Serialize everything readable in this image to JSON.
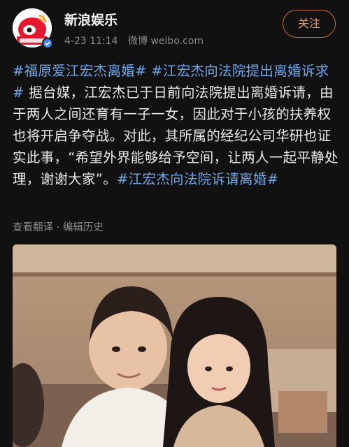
{
  "account": {
    "name": "新浪娱乐",
    "date": "4-23 11:14",
    "source": "微博 weibo.com",
    "follow_label": "关注"
  },
  "post": {
    "segments": [
      {
        "text": "#福原爱江宏杰离婚#",
        "tag": true
      },
      {
        "text": " ",
        "tag": false
      },
      {
        "text": "#江宏杰向法院提出离婚诉求#",
        "tag": true
      },
      {
        "text": " 据台媒，江宏杰已于日前向法院提出离婚诉请，由于两人之间还育有一子一女，因此对于小孩的扶养权也将开启争夺战。对此，其所属的经纪公司华研也证实此事，“希望外界能够给予空间，让两人一起平静处理，谢谢大家”。",
        "tag": false
      },
      {
        "text": "#江宏杰向法院诉请离婚#",
        "tag": true
      }
    ]
  },
  "actions": {
    "translate": "查看翻译",
    "separator": " · ",
    "history": "编辑历史"
  },
  "colors": {
    "background": "#111112",
    "hashtag": "#6ea6e8",
    "follow": "#ef9a60"
  }
}
